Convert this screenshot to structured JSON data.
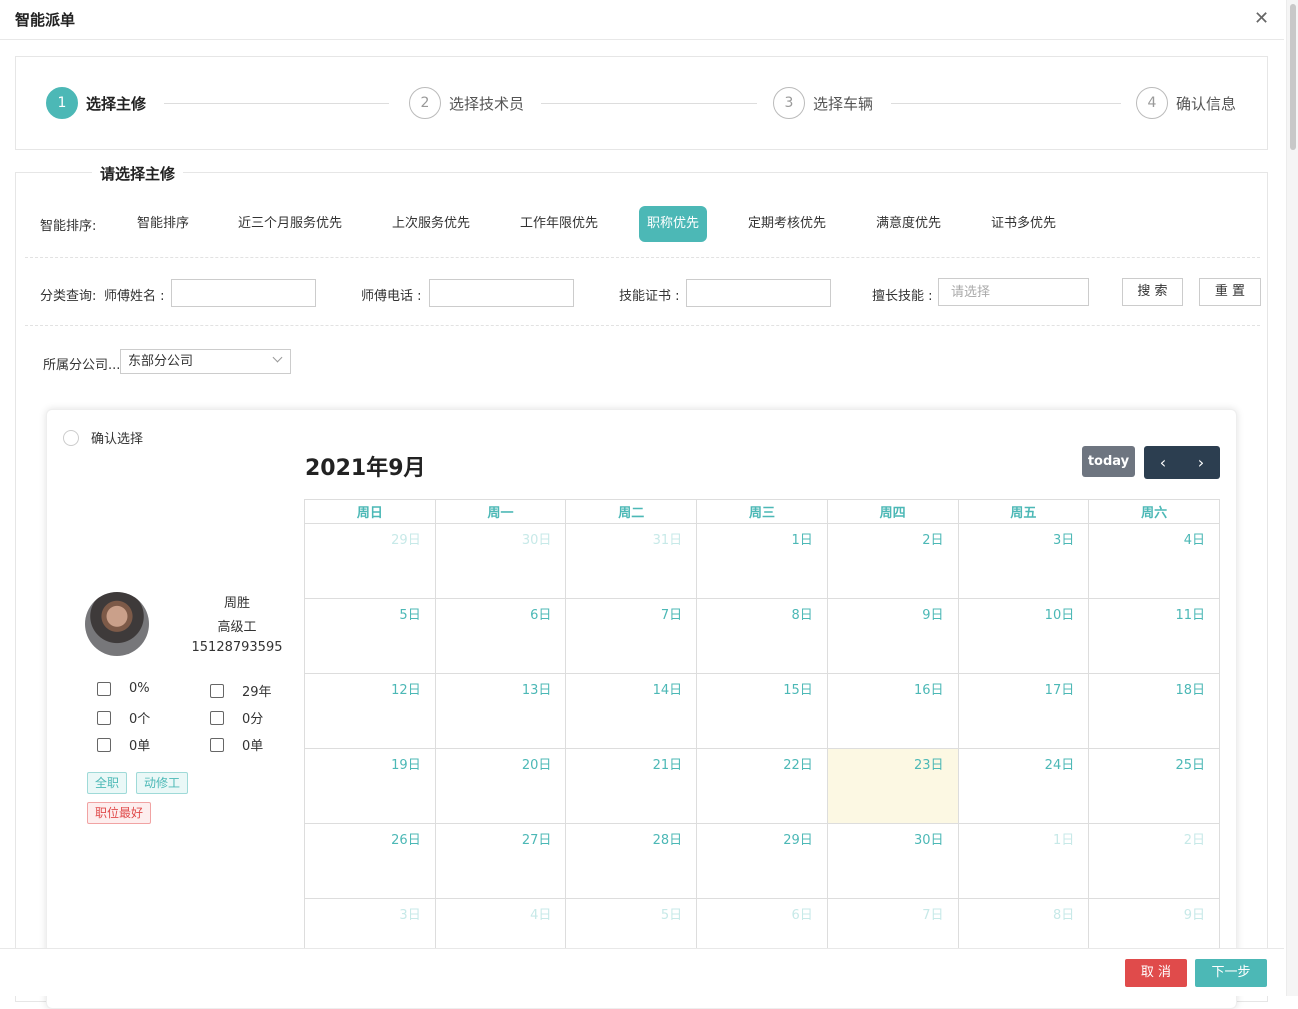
{
  "dialog": {
    "title": "智能派单",
    "close_icon": "close-icon"
  },
  "steps": [
    {
      "num": "1",
      "label": "选择主修"
    },
    {
      "num": "2",
      "label": "选择技术员"
    },
    {
      "num": "3",
      "label": "选择车辆"
    },
    {
      "num": "4",
      "label": "确认信息"
    }
  ],
  "section_title": "请选择主修",
  "sort": {
    "label": "智能排序:",
    "items": [
      "智能排序",
      "近三个月服务优先",
      "上次服务优先",
      "工作年限优先",
      "职称优先",
      "定期考核优先",
      "满意度优先",
      "证书多优先"
    ],
    "active": "职称优先"
  },
  "query": {
    "label": "分类查询:",
    "name_label": "师傅姓名 :",
    "phone_label": "师傅电话 :",
    "cert_label": "技能证书 :",
    "skill_label": "擅长技能 :",
    "skill_placeholder": "请选择",
    "search_button": "搜 索",
    "reset_button": "重 置"
  },
  "company": {
    "label": "所属分公司...",
    "value": "东部分公司"
  },
  "technician": {
    "confirm_label": "确认选择",
    "name": "周胜",
    "title": "高级工",
    "phone": "15128793595",
    "stats": {
      "rate": "0%",
      "years": "29年",
      "count": "0个",
      "score": "0分",
      "orders1": "0单",
      "orders2": "0单"
    },
    "tags": [
      "全职",
      "动修工",
      "职位最好"
    ]
  },
  "calendar": {
    "title": "2021年9月",
    "today_label": "today",
    "prev_icon": "‹",
    "next_icon": "›",
    "weekdays": [
      "周日",
      "周一",
      "周二",
      "周三",
      "周四",
      "周五",
      "周六"
    ],
    "weeks": [
      [
        "29日",
        "30日",
        "31日",
        "1日",
        "2日",
        "3日",
        "4日"
      ],
      [
        "5日",
        "6日",
        "7日",
        "8日",
        "9日",
        "10日",
        "11日"
      ],
      [
        "12日",
        "13日",
        "14日",
        "15日",
        "16日",
        "17日",
        "18日"
      ],
      [
        "19日",
        "20日",
        "21日",
        "22日",
        "23日",
        "24日",
        "25日"
      ],
      [
        "26日",
        "27日",
        "28日",
        "29日",
        "30日",
        "1日",
        "2日"
      ],
      [
        "3日",
        "4日",
        "5日",
        "6日",
        "7日",
        "8日",
        "9日"
      ]
    ],
    "today": "23日",
    "colors": {
      "accent": "#4cb8b6",
      "today_bg": "#fcf8e3",
      "nav": "#2c3e50"
    }
  },
  "footer": {
    "cancel": "取 消",
    "next": "下一步"
  }
}
